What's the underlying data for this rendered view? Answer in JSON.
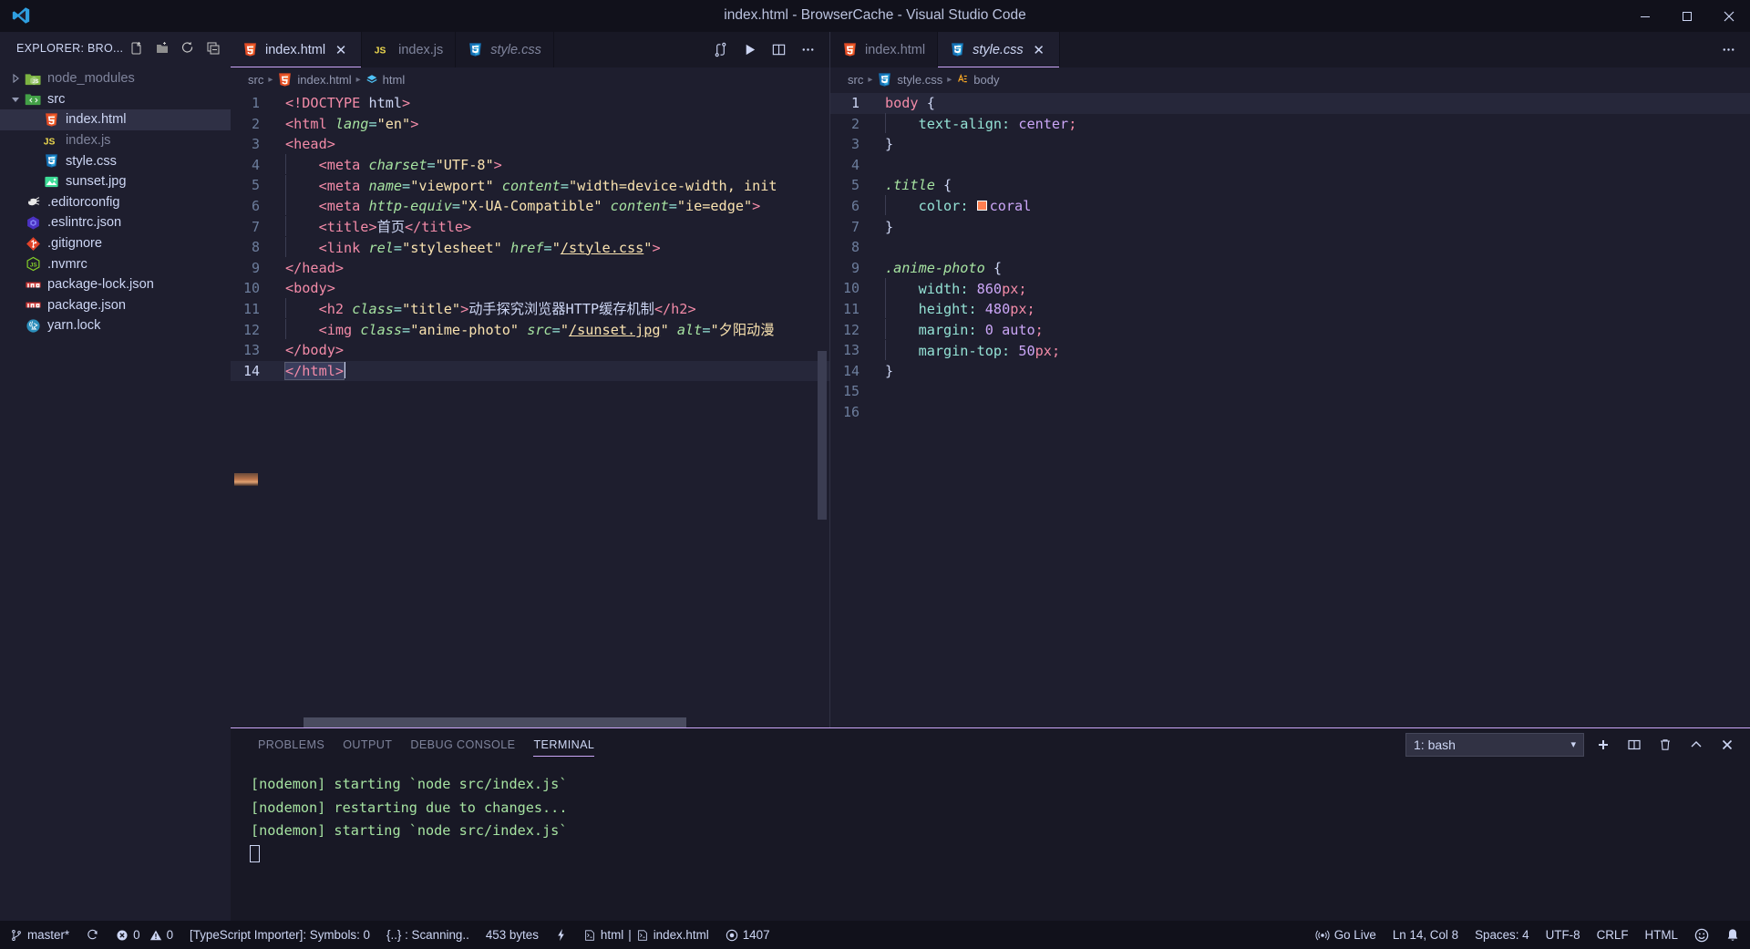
{
  "window": {
    "title": "index.html - BrowserCache - Visual Studio Code",
    "minimize": "—",
    "maximize": "❐",
    "close": "✕"
  },
  "sidebar": {
    "title": "EXPLORER: BRO...",
    "actions": [
      {
        "name": "new-file-icon",
        "label": "New File"
      },
      {
        "name": "new-folder-icon",
        "label": "New Folder"
      },
      {
        "name": "refresh-icon",
        "label": "Refresh Explorer"
      },
      {
        "name": "collapse-all-icon",
        "label": "Collapse Folders in Explorer"
      }
    ],
    "items": [
      {
        "label": "node_modules",
        "type": "folder",
        "icon": "node-folder-icon",
        "expanded": false,
        "depth": 0,
        "dim": true
      },
      {
        "label": "src",
        "type": "folder",
        "icon": "src-folder-icon",
        "expanded": true,
        "depth": 0,
        "dim": false
      },
      {
        "label": "index.html",
        "type": "file",
        "icon": "html5-icon",
        "depth": 1,
        "selected": true,
        "dim": false
      },
      {
        "label": "index.js",
        "type": "file",
        "icon": "js-icon",
        "depth": 1,
        "selected": false,
        "dim": true
      },
      {
        "label": "style.css",
        "type": "file",
        "icon": "css3-icon",
        "depth": 1,
        "selected": false,
        "dim": false
      },
      {
        "label": "sunset.jpg",
        "type": "file",
        "icon": "image-icon",
        "depth": 1,
        "selected": false,
        "dim": false
      },
      {
        "label": ".editorconfig",
        "type": "file",
        "icon": "editorconfig-icon",
        "depth": 0,
        "selected": false,
        "dim": false
      },
      {
        "label": ".eslintrc.json",
        "type": "file",
        "icon": "eslint-icon",
        "depth": 0,
        "selected": false,
        "dim": false
      },
      {
        "label": ".gitignore",
        "type": "file",
        "icon": "git-icon",
        "depth": 0,
        "selected": false,
        "dim": false
      },
      {
        "label": ".nvmrc",
        "type": "file",
        "icon": "node-icon",
        "depth": 0,
        "selected": false,
        "dim": false
      },
      {
        "label": "package-lock.json",
        "type": "file",
        "icon": "npm-icon",
        "depth": 0,
        "selected": false,
        "dim": false
      },
      {
        "label": "package.json",
        "type": "file",
        "icon": "npm-icon",
        "depth": 0,
        "selected": false,
        "dim": false
      },
      {
        "label": "yarn.lock",
        "type": "file",
        "icon": "yarn-icon",
        "depth": 0,
        "selected": false,
        "dim": false
      }
    ]
  },
  "editor_left": {
    "tabs": [
      {
        "label": "index.html",
        "icon": "html5-icon",
        "active": true,
        "italic": false,
        "close": "✕"
      },
      {
        "label": "index.js",
        "icon": "js-icon",
        "active": false,
        "italic": false
      },
      {
        "label": "style.css",
        "icon": "css3-icon",
        "active": false,
        "italic": true
      }
    ],
    "actions": [
      {
        "name": "split-compare-icon",
        "label": "Compare"
      },
      {
        "name": "run-icon",
        "label": "Run"
      },
      {
        "name": "split-editor-icon",
        "label": "Split Editor"
      },
      {
        "name": "more-actions-icon",
        "label": "More Actions..."
      }
    ],
    "breadcrumb": [
      "src",
      "index.html",
      "html"
    ],
    "lines": [
      {
        "n": "1",
        "text": "<!DOCTYPE html>"
      },
      {
        "n": "2",
        "text": "<html lang=\"en\">"
      },
      {
        "n": "3",
        "text": "<head>"
      },
      {
        "n": "4",
        "text": "    <meta charset=\"UTF-8\">"
      },
      {
        "n": "5",
        "text": "    <meta name=\"viewport\" content=\"width=device-width, init"
      },
      {
        "n": "6",
        "text": "    <meta http-equiv=\"X-UA-Compatible\" content=\"ie=edge\">"
      },
      {
        "n": "7",
        "text": "    <title>首页</title>"
      },
      {
        "n": "8",
        "text": "    <link rel=\"stylesheet\" href=\"/style.css\">"
      },
      {
        "n": "9",
        "text": "</head>"
      },
      {
        "n": "10",
        "text": "<body>"
      },
      {
        "n": "11",
        "text": "    <h2 class=\"title\">动手探究浏览器HTTP缓存机制</h2>"
      },
      {
        "n": "12",
        "text": "    <img class=\"anime-photo\" src=\"/sunset.jpg\" alt=\"夕阳动漫"
      },
      {
        "n": "13",
        "text": "</body>"
      },
      {
        "n": "14",
        "text": "</html>"
      }
    ]
  },
  "editor_right": {
    "tabs": [
      {
        "label": "index.html",
        "icon": "html5-icon",
        "active": false,
        "italic": false
      },
      {
        "label": "style.css",
        "icon": "css3-icon",
        "active": true,
        "italic": true,
        "close": "✕"
      }
    ],
    "actions": [
      {
        "name": "more-actions-icon",
        "label": "More Actions..."
      }
    ],
    "breadcrumb": [
      "src",
      "style.css",
      "body"
    ],
    "lines": [
      {
        "n": "1",
        "text": "body {"
      },
      {
        "n": "2",
        "text": "    text-align: center;"
      },
      {
        "n": "3",
        "text": "}"
      },
      {
        "n": "4",
        "text": ""
      },
      {
        "n": "5",
        "text": ".title {"
      },
      {
        "n": "6",
        "text": "    color: coral"
      },
      {
        "n": "7",
        "text": "}"
      },
      {
        "n": "8",
        "text": ""
      },
      {
        "n": "9",
        "text": ".anime-photo {"
      },
      {
        "n": "10",
        "text": "    width: 860px;"
      },
      {
        "n": "11",
        "text": "    height: 480px;"
      },
      {
        "n": "12",
        "text": "    margin: 0 auto;"
      },
      {
        "n": "13",
        "text": "    margin-top: 50px;"
      },
      {
        "n": "14",
        "text": "}"
      },
      {
        "n": "15",
        "text": ""
      },
      {
        "n": "16",
        "text": ""
      }
    ],
    "color_swatch": "#ff7f50"
  },
  "panel": {
    "tabs": [
      {
        "label": "PROBLEMS",
        "active": false
      },
      {
        "label": "OUTPUT",
        "active": false
      },
      {
        "label": "DEBUG CONSOLE",
        "active": false
      },
      {
        "label": "TERMINAL",
        "active": true
      }
    ],
    "terminal_select": "1: bash",
    "select_arrow": "▾",
    "actions": [
      {
        "name": "new-terminal-icon",
        "label": "New Terminal"
      },
      {
        "name": "split-terminal-icon",
        "label": "Split Terminal"
      },
      {
        "name": "kill-terminal-icon",
        "label": "Kill Terminal"
      },
      {
        "name": "maximize-panel-icon",
        "label": "Maximize Panel Size"
      },
      {
        "name": "close-panel-icon",
        "label": "Close Panel"
      }
    ],
    "terminal_lines": [
      "[nodemon] starting `node src/index.js`",
      "[nodemon] restarting due to changes...",
      "[nodemon] starting `node src/index.js`"
    ]
  },
  "statusbar": {
    "branch": "master*",
    "sync_icon": "sync-icon",
    "errors": "0",
    "warnings": "0",
    "typescript_importer": "[TypeScript Importer]: Symbols: 0",
    "scanning": "{..} : Scanning..",
    "bytes": "453 bytes",
    "lightning_icon": "lightning-icon",
    "format_html": "html",
    "format_sep": "|",
    "format_file": "index.html",
    "eye_count": "1407",
    "go_live": "Go Live",
    "position": "Ln 14, Col 8",
    "indentation": "Spaces: 4",
    "encoding": "UTF-8",
    "eol": "CRLF",
    "language": "HTML",
    "feedback_icon": "smiley-icon",
    "bell_icon": "bell-icon"
  },
  "colors": {
    "accent": "#cba6f7",
    "terminal_text": "#a6e3a1",
    "background": "#1e1e2e",
    "coral": "#ff7f50"
  }
}
